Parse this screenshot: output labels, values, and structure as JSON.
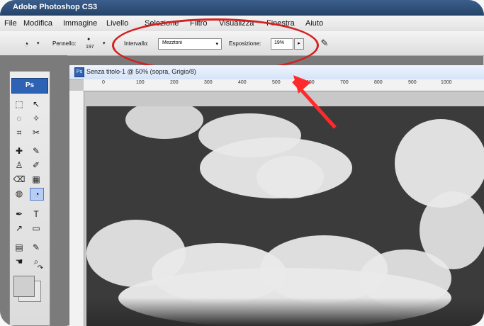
{
  "app_title": "Adobe Photoshop CS3",
  "menu": {
    "items": [
      "File",
      "Modifica",
      "Immagine",
      "Livello",
      "Selezione",
      "Filtro",
      "Visualizza",
      "Finestra",
      "Aiuto"
    ]
  },
  "options": {
    "brush_label": "Pennello:",
    "brush_size": "197",
    "range_label": "Intervallo:",
    "range_value": "Mezztoni",
    "exposure_label": "Esposizione:",
    "exposure_value": "19%"
  },
  "toolbox": {
    "logo": "Ps"
  },
  "document": {
    "title": "Senza titolo-1 @ 50% (sopra, Grigio/8)",
    "ruler_marks": [
      "0",
      "100",
      "200",
      "300",
      "400",
      "500",
      "600",
      "700",
      "800",
      "900",
      "1000"
    ]
  },
  "colors": {
    "titlebar": "#2f5382",
    "highlight": "#d32020",
    "arrow": "#ff2a2a"
  }
}
